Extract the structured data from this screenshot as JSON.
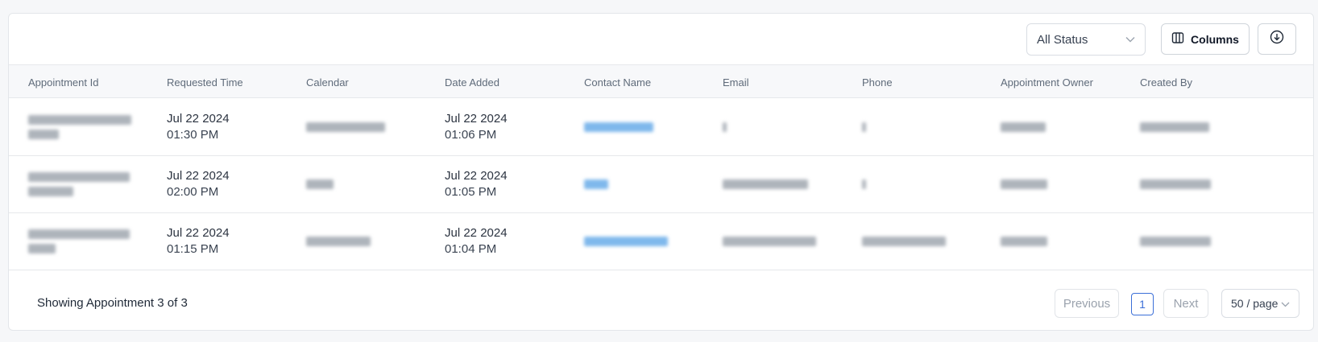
{
  "toolbar": {
    "status_filter": "All Status",
    "columns_label": "Columns",
    "download_icon": "download-icon"
  },
  "table": {
    "columns": [
      "Appointment Id",
      "Requested Time",
      "Calendar",
      "Date Added",
      "Contact Name",
      "Email",
      "Phone",
      "Appointment Owner",
      "Created By"
    ],
    "rows": [
      {
        "requested_date": "Jul 22 2024",
        "requested_time": "01:30 PM",
        "added_date": "Jul 22 2024",
        "added_time": "01:06 PM"
      },
      {
        "requested_date": "Jul 22 2024",
        "requested_time": "02:00 PM",
        "added_date": "Jul 22 2024",
        "added_time": "01:05 PM"
      },
      {
        "requested_date": "Jul 22 2024",
        "requested_time": "01:15 PM",
        "added_date": "Jul 22 2024",
        "added_time": "01:04 PM"
      }
    ]
  },
  "footer": {
    "showing": "Showing Appointment 3 of 3",
    "previous": "Previous",
    "page": "1",
    "next": "Next",
    "per_page": "50 / page"
  },
  "colors": {
    "accent": "#3b6fd8",
    "link": "#7fb8ec"
  }
}
